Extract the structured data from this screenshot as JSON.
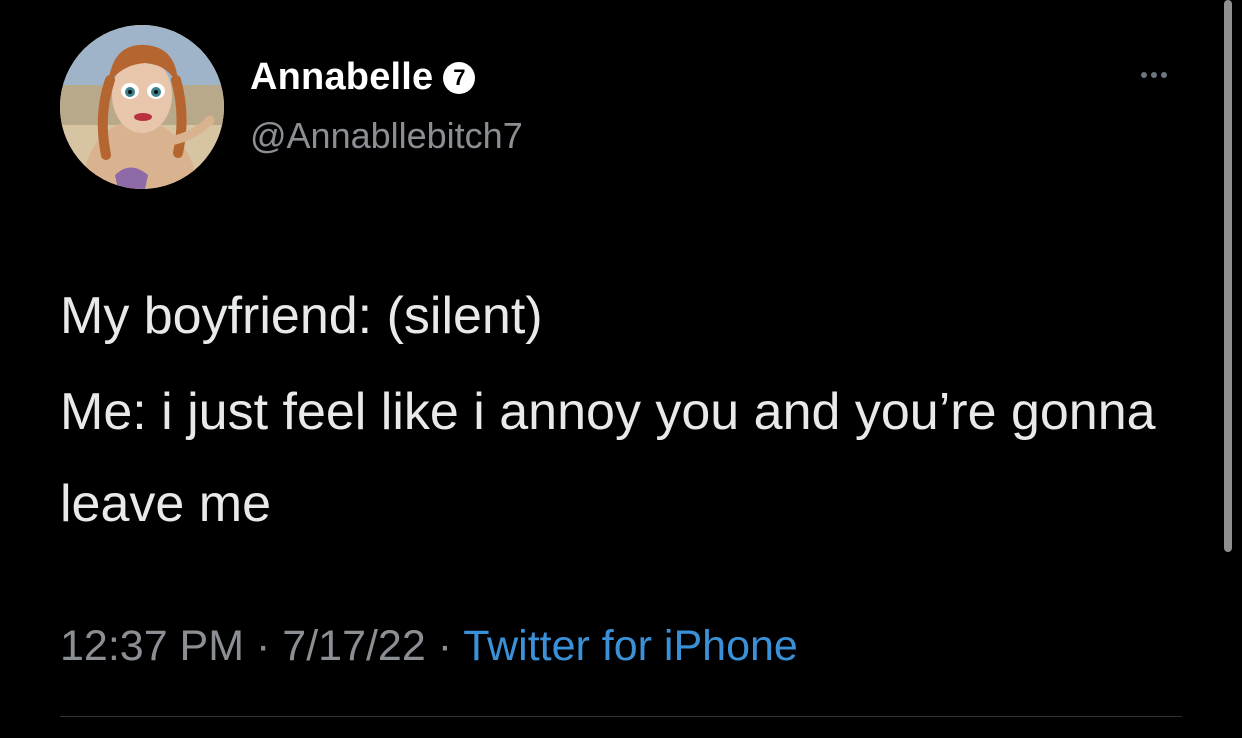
{
  "tweet": {
    "display_name": "Annabelle",
    "badge": "7",
    "handle": "@Annabllebitch7",
    "body": [
      "My boyfriend: (silent)",
      "Me: i just feel like i annoy you and you’re gonna leave me"
    ],
    "meta": {
      "time": "12:37 PM",
      "separator": "·",
      "date": "7/17/22",
      "source": "Twitter for iPhone"
    }
  },
  "icons": {
    "more": "more-horizontal-icon"
  },
  "colors": {
    "background": "#000000",
    "text": "#e7e9ea",
    "secondary": "#8b8f94",
    "link": "#3b91d8"
  }
}
